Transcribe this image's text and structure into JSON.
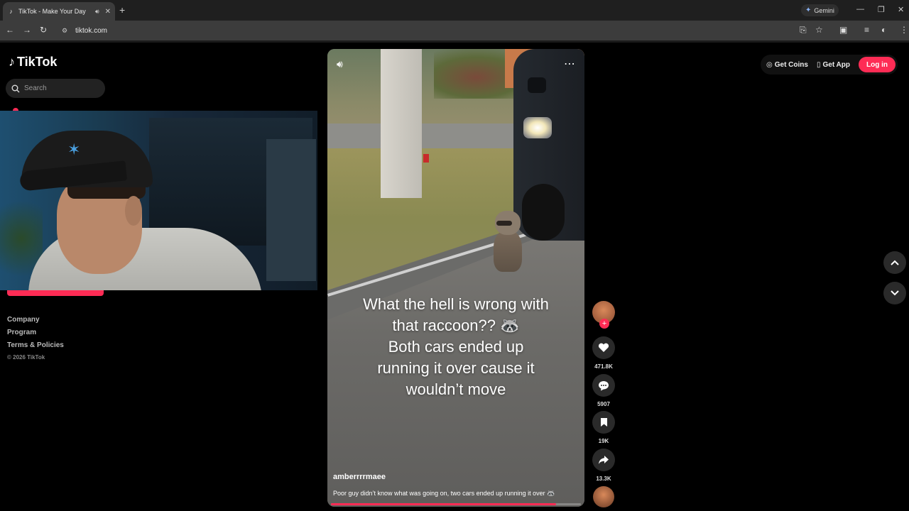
{
  "browser": {
    "tab_title": "TikTok - Make Your Day",
    "favicon": "tiktok-icon",
    "new_tab": "+",
    "gemini_label": "Gemini",
    "url": "tiktok.com"
  },
  "sidebar": {
    "brand": "TikTok",
    "search_placeholder": "Search",
    "footer": {
      "company": "Company",
      "program": "Program",
      "terms": "Terms & Policies",
      "copyright": "© 2026 TikTok"
    }
  },
  "video": {
    "caption_lines": [
      "What the hell is wrong with",
      "that raccoon?? 🦝",
      "Both cars ended up",
      "running it over cause it",
      "wouldn’t move"
    ],
    "author": "amberrrrmaee",
    "description": "Poor guy didn’t know what was going on, two cars ended up running it over 🦝",
    "progress": 0.9
  },
  "actions": {
    "likes": "471.8K",
    "comments": "5907",
    "saves": "19K",
    "shares": "13.3K"
  },
  "header": {
    "get_coins": "Get Coins",
    "get_app": "Get App",
    "login": "Log in"
  },
  "colors": {
    "accent": "#fe2c55",
    "background": "#000000"
  }
}
